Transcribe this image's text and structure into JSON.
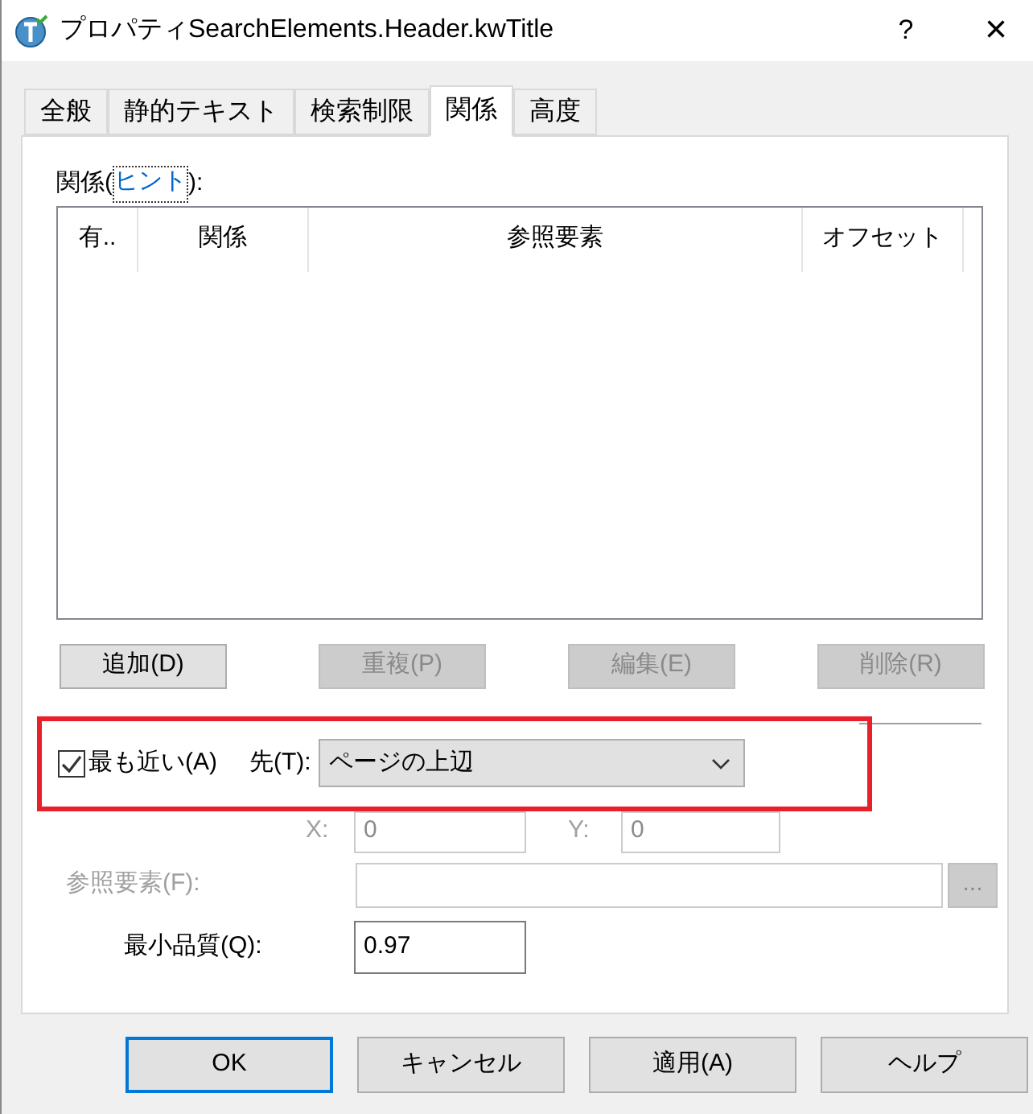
{
  "window": {
    "title": "プロパティSearchElements.Header.kwTitle",
    "help": "?",
    "close": "×"
  },
  "tabs": [
    {
      "label": "全般",
      "selected": false
    },
    {
      "label": "静的テキスト",
      "selected": false
    },
    {
      "label": "検索制限",
      "selected": false
    },
    {
      "label": "関係",
      "selected": true
    },
    {
      "label": "高度",
      "selected": false
    }
  ],
  "relations": {
    "label": "関係(",
    "hint_link": "ヒント",
    "label_end": "):",
    "columns": [
      "有..",
      "関係",
      "参照要素",
      "オフセット"
    ],
    "buttons": [
      {
        "label": "追加(D)",
        "disabled": false
      },
      {
        "label": "重複(P)",
        "disabled": true
      },
      {
        "label": "編集(E)",
        "disabled": true
      },
      {
        "label": "削除(R)",
        "disabled": true
      }
    ]
  },
  "highlighted": true,
  "nearest": {
    "label": "最も近い(A)",
    "checked": true
  },
  "target": {
    "label": "先(T):",
    "value": "ページの上辺"
  },
  "x": {
    "label": "X:",
    "value": "0",
    "disabled": true
  },
  "y": {
    "label": "Y:",
    "value": "0",
    "disabled": true
  },
  "reference_element": {
    "label": "参照要素(F):",
    "browse": "...",
    "disabled": true
  },
  "min_quality": {
    "label": "最小品質(Q):",
    "value": "0.97"
  },
  "dialog_buttons": [
    {
      "label": "OK",
      "default": true
    },
    {
      "label": "キャンセル",
      "default": false
    },
    {
      "label": "適用(A)",
      "default": false
    },
    {
      "label": "ヘルプ",
      "default": false
    }
  ]
}
